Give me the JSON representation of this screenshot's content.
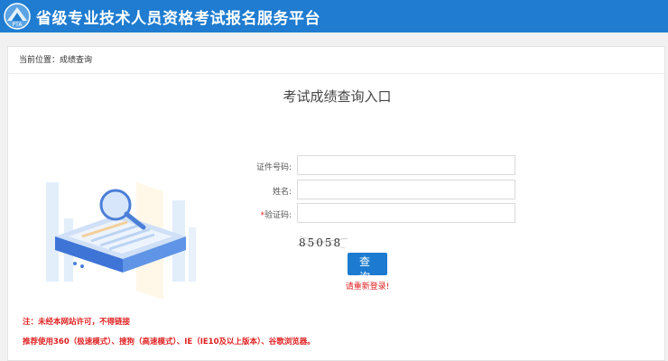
{
  "header": {
    "title": "省级专业技术人员资格考试报名服务平台",
    "logo_text": "PTA"
  },
  "breadcrumb": {
    "prefix": "当前位置：",
    "current": "成绩查询"
  },
  "page_title": "考试成绩查询入口",
  "form": {
    "id_label": "证件号码:",
    "name_label": "姓名:",
    "captcha_required_mark": "*",
    "captcha_label": "验证码:",
    "id_value": "",
    "name_value": "",
    "captcha_value": "",
    "captcha_image_text": "85058",
    "query_button": "查 询",
    "relogin_message": "请重新登录!"
  },
  "notes": {
    "copyright": "注：未经本网站许可，不得链接",
    "browser": "推荐使用360（极速模式）、搜狗（高速模式）、IE（IE10及以上版本）、谷歌浏览器。"
  },
  "colors": {
    "header_bg": "#1f7cd0",
    "button_bg": "#1c7bd0",
    "alert_red": "#e02020"
  }
}
